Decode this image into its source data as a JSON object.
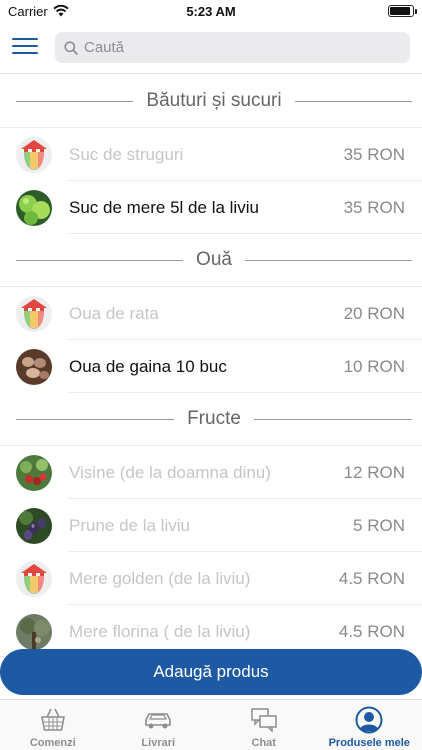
{
  "status_bar": {
    "carrier": "Carrier",
    "time": "5:23 AM",
    "battery_level": 0.9
  },
  "header": {
    "search_placeholder": "Caută"
  },
  "sections": [
    {
      "title": "Băuturi și sucuri",
      "items": [
        {
          "name": "Suc de struguri",
          "price": "35 RON",
          "active": false,
          "image": "placeholder"
        },
        {
          "name": "Suc de mere 5l de la liviu",
          "price": "35 RON",
          "active": true,
          "image": "apples"
        }
      ]
    },
    {
      "title": "Ouă",
      "items": [
        {
          "name": "Oua de rata",
          "price": "20 RON",
          "active": false,
          "image": "placeholder"
        },
        {
          "name": "Oua de gaina 10 buc",
          "price": "10 RON",
          "active": true,
          "image": "eggs"
        }
      ]
    },
    {
      "title": "Fructe",
      "items": [
        {
          "name": "Visine (de la doamna dinu)",
          "price": "12 RON",
          "active": false,
          "image": "cherries"
        },
        {
          "name": "Prune de la liviu",
          "price": "5 RON",
          "active": false,
          "image": "plums"
        },
        {
          "name": "Mere golden (de la liviu)",
          "price": "4.5 RON",
          "active": false,
          "image": "placeholder"
        },
        {
          "name": "Mere florina ( de la liviu)",
          "price": "4.5 RON",
          "active": false,
          "image": "tree"
        }
      ]
    }
  ],
  "add_button_label": "Adaugă produs",
  "tabs": [
    {
      "label": "Comenzi",
      "icon": "basket-icon",
      "selected": false
    },
    {
      "label": "Livrari",
      "icon": "car-icon",
      "selected": false
    },
    {
      "label": "Chat",
      "icon": "chat-icon",
      "selected": false
    },
    {
      "label": "Produsele mele",
      "icon": "profile-icon",
      "selected": true
    }
  ],
  "colors": {
    "accent": "#1d5aa3",
    "inactive_text": "#c6c6c6",
    "price_text": "#8a8a8a"
  }
}
